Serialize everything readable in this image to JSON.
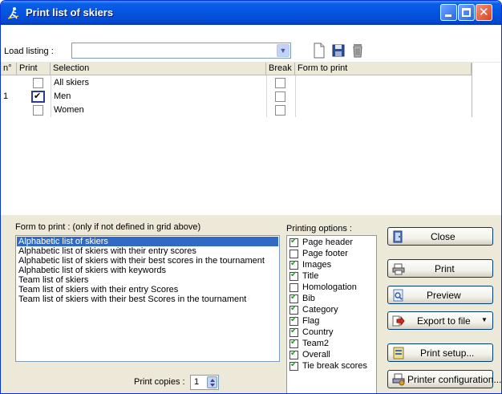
{
  "window": {
    "title": "Print list of skiers"
  },
  "load": {
    "label": "Load listing :",
    "value": ""
  },
  "grid": {
    "headers": {
      "num": "n°",
      "print": "Print",
      "selection": "Selection",
      "break": "Break",
      "form": "Form to print"
    },
    "rows": [
      {
        "num": "",
        "print": false,
        "selection": "All skiers",
        "break": false,
        "form": ""
      },
      {
        "num": "1",
        "print": true,
        "selection": "Men",
        "break": false,
        "form": ""
      },
      {
        "num": "",
        "print": false,
        "selection": "Women",
        "break": false,
        "form": ""
      }
    ]
  },
  "form_to_print": {
    "label": "Form to print :  (only if not defined in grid above)",
    "items": [
      "Alphabetic list of skiers",
      "Alphabetic list of skiers with their entry scores",
      "Alphabetic list of skiers with their best scores in the tournament",
      "Alphabetic list of skiers with keywords",
      "Team list of skiers",
      "Team list of skiers with their entry Scores",
      "Team list of skiers with their best Scores in the tournament"
    ],
    "selected_index": 0
  },
  "copies": {
    "label": "Print copies :",
    "value": "1"
  },
  "printing_options": {
    "label": "Printing options :",
    "items": [
      {
        "label": "Page header",
        "checked": true
      },
      {
        "label": "Page footer",
        "checked": false
      },
      {
        "label": "Images",
        "checked": true
      },
      {
        "label": "Title",
        "checked": true
      },
      {
        "label": "Homologation",
        "checked": false
      },
      {
        "label": "Bib",
        "checked": true
      },
      {
        "label": "Category",
        "checked": true
      },
      {
        "label": "Flag",
        "checked": true
      },
      {
        "label": "Country",
        "checked": true
      },
      {
        "label": "Team2",
        "checked": true
      },
      {
        "label": "Overall",
        "checked": true
      },
      {
        "label": "Tie break scores",
        "checked": true
      }
    ]
  },
  "buttons": {
    "close": "Close",
    "print": "Print",
    "preview": "Preview",
    "export": "Export to file",
    "print_setup": "Print setup...",
    "printer_config": "Printer configuration..."
  },
  "icons": {
    "window": "skier-icon",
    "new": "new-document-icon",
    "save": "save-icon",
    "delete": "trash-icon"
  }
}
